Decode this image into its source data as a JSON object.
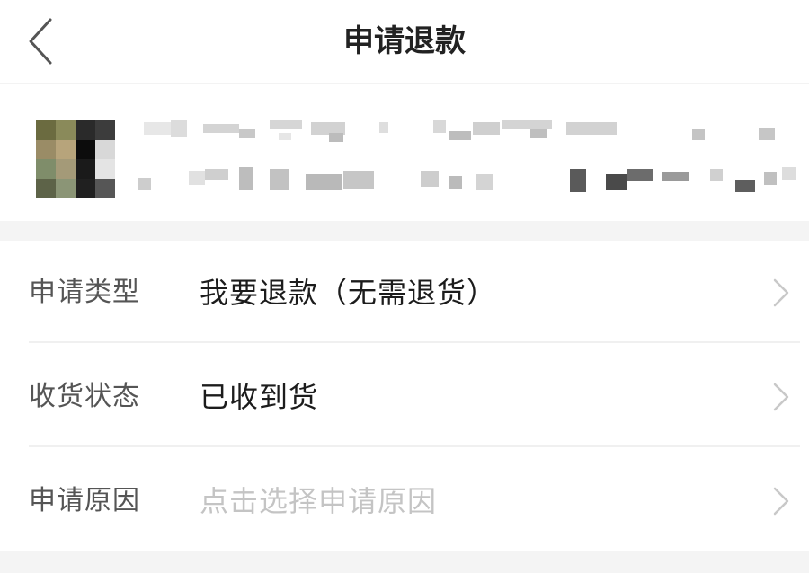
{
  "header": {
    "title": "申请退款",
    "back_icon": "chevron-left-icon"
  },
  "product": {
    "thumbnail": "pixelated-thumbnail",
    "info": "pixelated-product-info"
  },
  "form": {
    "rows": [
      {
        "label": "申请类型",
        "value": "我要退款（无需退货）",
        "is_placeholder": false,
        "icon": "chevron-right-icon"
      },
      {
        "label": "收货状态",
        "value": "已收到货",
        "is_placeholder": false,
        "icon": "chevron-right-icon"
      },
      {
        "label": "申请原因",
        "value": "点击选择申请原因",
        "is_placeholder": true,
        "icon": "chevron-right-icon"
      }
    ]
  },
  "colors": {
    "background": "#ffffff",
    "band": "#f4f4f4",
    "title_text": "#222222",
    "label_text": "#555555",
    "value_text": "#1c1c1c",
    "placeholder_text": "#c4c4c4",
    "chevron": "#c8c8c8"
  }
}
